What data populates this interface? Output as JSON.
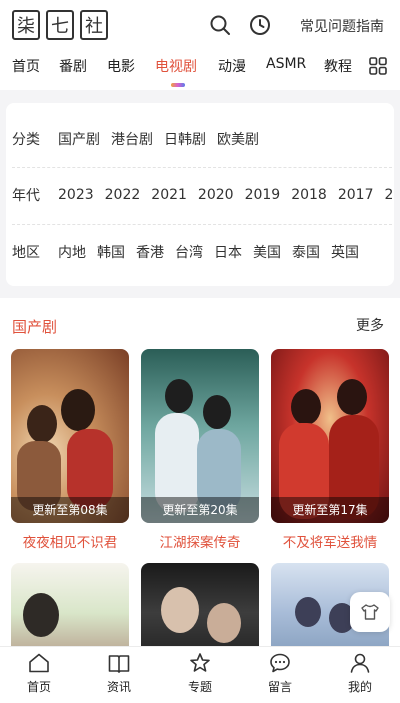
{
  "logo": {
    "chars": [
      "柒",
      "七",
      "社"
    ]
  },
  "header": {
    "faq_label": "常见问题指南"
  },
  "nav": {
    "items": [
      {
        "label": "首页"
      },
      {
        "label": "番剧"
      },
      {
        "label": "电影"
      },
      {
        "label": "电视剧"
      },
      {
        "label": "动漫"
      },
      {
        "label": "ASMR"
      },
      {
        "label": "教程"
      }
    ],
    "active_index": 3
  },
  "filters": {
    "category": {
      "label": "分类",
      "options": [
        "国产剧",
        "港台剧",
        "日韩剧",
        "欧美剧"
      ]
    },
    "year": {
      "label": "年代",
      "options": [
        "2023",
        "2022",
        "2021",
        "2020",
        "2019",
        "2018",
        "2017",
        "2"
      ]
    },
    "region": {
      "label": "地区",
      "options": [
        "内地",
        "韩国",
        "香港",
        "台湾",
        "日本",
        "美国",
        "泰国",
        "英国"
      ]
    }
  },
  "section": {
    "title": "国产剧",
    "more_label": "更多",
    "cards": [
      {
        "badge": "更新至第08集",
        "title": "夜夜相见不识君"
      },
      {
        "badge": "更新至第20集",
        "title": "江湖探案传奇"
      },
      {
        "badge": "更新至第17集",
        "title": "不及将军送我情"
      },
      {
        "badge": "",
        "title": ""
      },
      {
        "badge": "",
        "title": ""
      },
      {
        "badge": "",
        "title": ""
      }
    ]
  },
  "tabbar": {
    "items": [
      {
        "label": "首页",
        "icon": "home-icon"
      },
      {
        "label": "资讯",
        "icon": "book-icon"
      },
      {
        "label": "专题",
        "icon": "star-icon"
      },
      {
        "label": "留言",
        "icon": "chat-icon"
      },
      {
        "label": "我的",
        "icon": "user-icon"
      }
    ]
  },
  "colors": {
    "accent": "#e0523c",
    "text": "#222222",
    "background": "#f4f4f6"
  }
}
